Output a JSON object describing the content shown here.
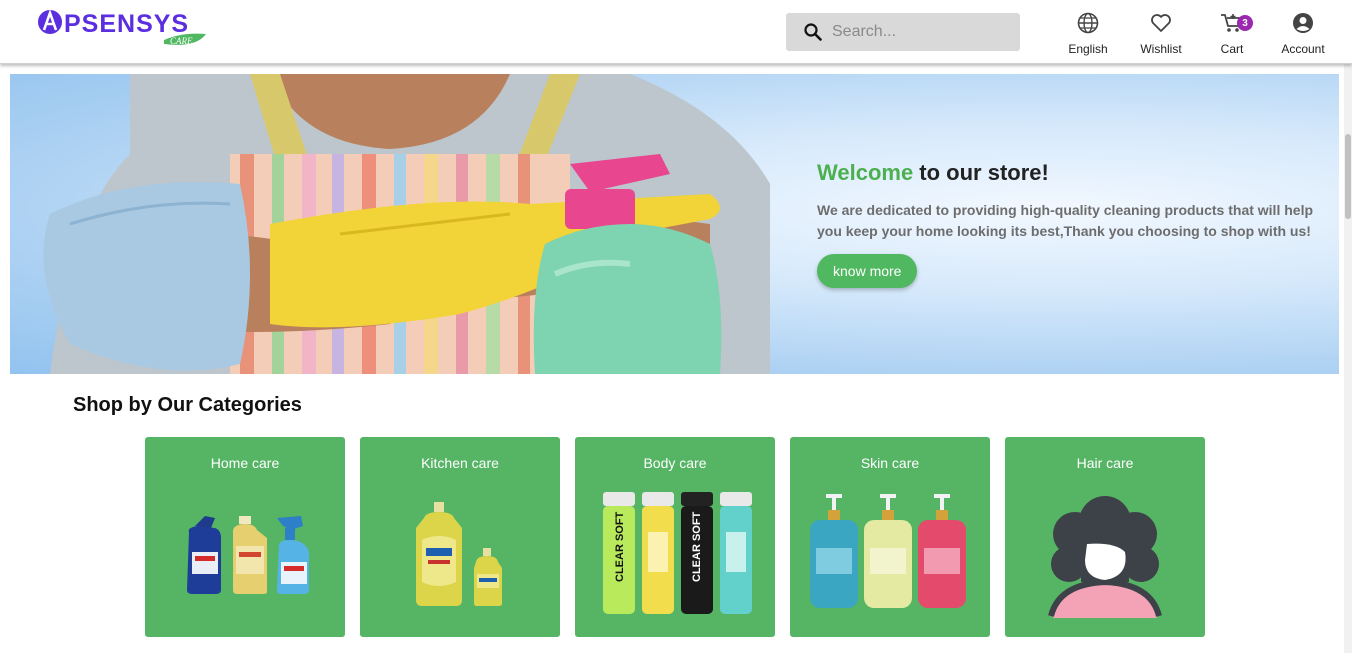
{
  "brand": {
    "logo_text": "APSENSYS",
    "logo_sub": "CARE",
    "primary_color": "#4fb860",
    "accent_color": "#5b2ee0"
  },
  "search": {
    "placeholder": "Search..."
  },
  "nav": {
    "language": "English",
    "wishlist": "Wishlist",
    "cart": "Cart",
    "cart_count": "3",
    "account": "Account"
  },
  "hero": {
    "title_accent": "Welcome",
    "title_rest": " to our store!",
    "description": "We are dedicated to providing high-quality cleaning products that will help you keep your home looking its best,Thank you choosing to shop with us!",
    "button": "know more"
  },
  "categories": {
    "title": "Shop by Our Categories",
    "items": [
      {
        "label": "Home care",
        "icon": "home-care-products"
      },
      {
        "label": "Kitchen care",
        "icon": "kitchen-care-products"
      },
      {
        "label": "Body care",
        "icon": "body-care-products"
      },
      {
        "label": "Skin care",
        "icon": "skin-care-products"
      },
      {
        "label": "Hair care",
        "icon": "hair-care-avatar"
      }
    ]
  }
}
